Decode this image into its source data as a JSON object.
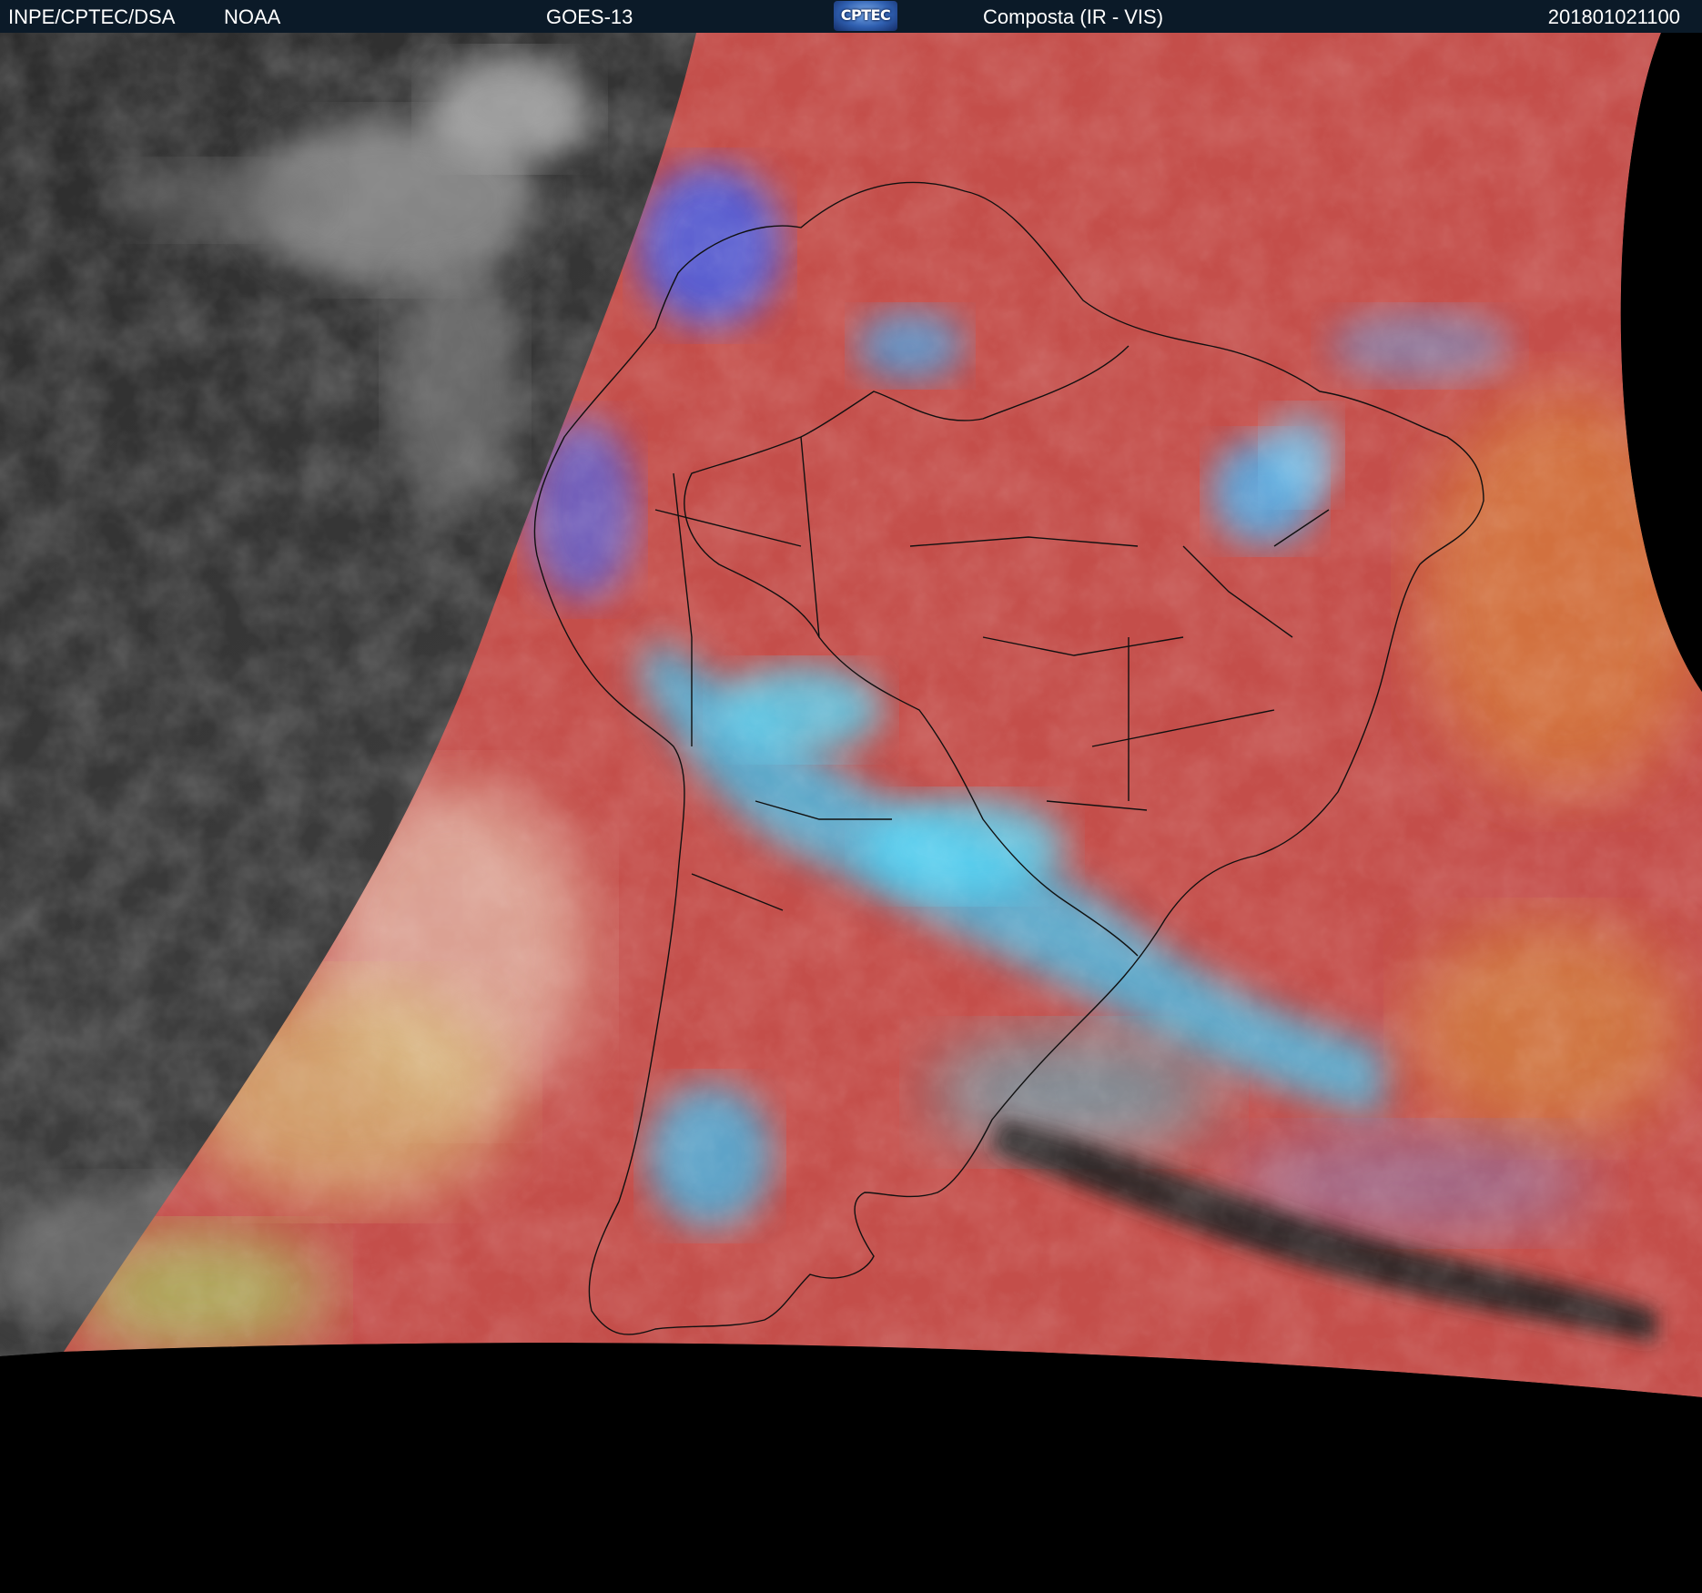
{
  "header": {
    "organization": "INPE/CPTEC/DSA",
    "agency": "NOAA",
    "satellite": "GOES-13",
    "logo_text": "CPTEC",
    "product": "Composta (IR - VIS)",
    "timestamp": "201801021100"
  },
  "colors": {
    "header_bg": "#0b1a28",
    "night_ir": "#3a3a3a",
    "composite_land": "#b84a48",
    "composite_ocean": "#c9524a",
    "cold_cloud_cyan": "#34c8f5",
    "low_cloud_yellow": "#cfc27a",
    "coastline": "#101010",
    "space": "#000000"
  },
  "map": {
    "region": "South America",
    "features": [
      "continent-outline",
      "country-borders",
      "brazil-state-borders",
      "night-terminator",
      "frontal-cloud-band",
      "dry-slot"
    ]
  }
}
